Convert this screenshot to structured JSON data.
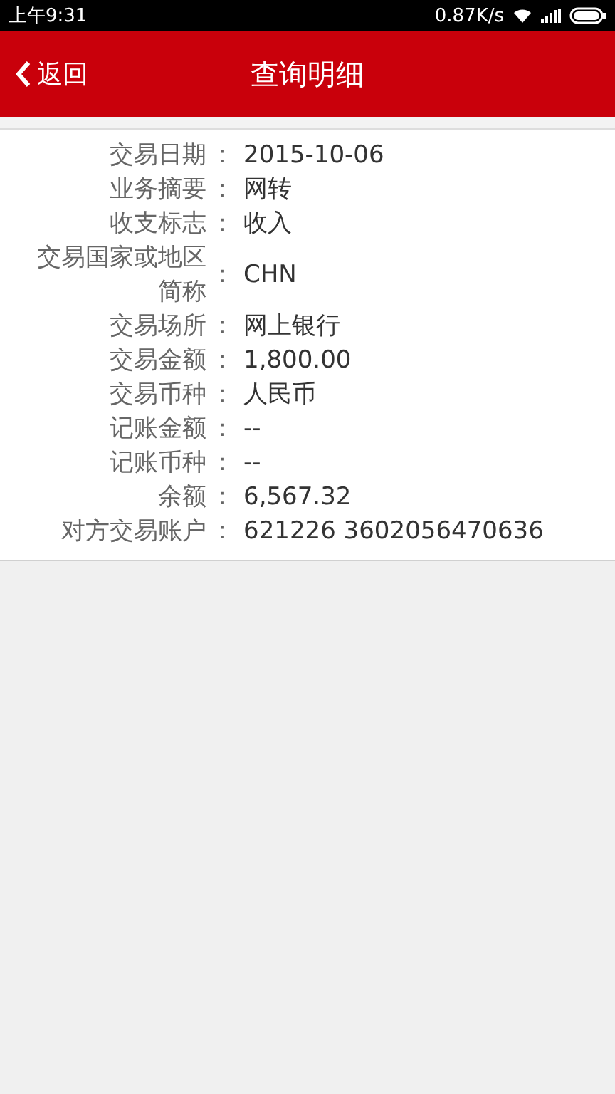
{
  "status_bar": {
    "time": "上午9:31",
    "speed": "0.87K/s"
  },
  "header": {
    "back": "返回",
    "title": "查询明细"
  },
  "details": [
    {
      "label": "交易日期",
      "separator": "：",
      "value": "2015-10-06"
    },
    {
      "label": "业务摘要",
      "separator": "：",
      "value": "网转"
    },
    {
      "label": "收支标志",
      "separator": "：",
      "value": "收入"
    },
    {
      "label": "交易国家或地区简称",
      "separator": "：",
      "value": "CHN"
    },
    {
      "label": "交易场所",
      "separator": "：",
      "value": "网上银行"
    },
    {
      "label": "交易金额",
      "separator": "：",
      "value": "1,800.00"
    },
    {
      "label": "交易币种",
      "separator": "：",
      "value": "人民币"
    },
    {
      "label": "记账金额",
      "separator": "：",
      "value": "--"
    },
    {
      "label": "记账币种",
      "separator": "：",
      "value": "--"
    },
    {
      "label": "余额",
      "separator": "：",
      "value": "6,567.32"
    },
    {
      "label": "对方交易账户",
      "separator": "：",
      "value": "621226 3602056470636"
    }
  ]
}
